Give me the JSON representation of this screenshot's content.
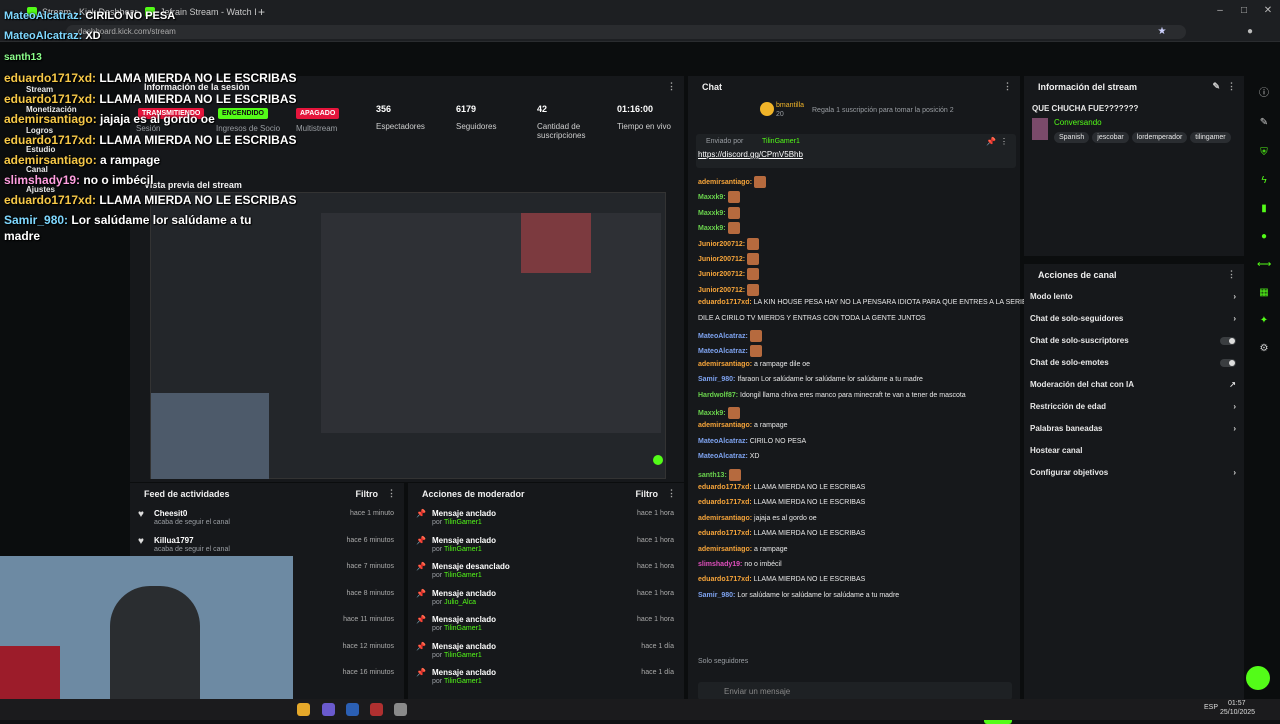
{
  "browser": {
    "tabs": [
      {
        "label": "Stream - Kick Dashboard"
      },
      {
        "label": "Jefrain Stream - Watch Live on"
      }
    ],
    "url": "dashboard.kick.com/stream",
    "new_tab": "+"
  },
  "overlay": {
    "top_lines": [
      {
        "user": "MateoAlcatraz:",
        "msg": "CIRILO NO PESA"
      },
      {
        "user": "MateoAlcatraz:",
        "msg": "XD"
      }
    ],
    "lines": [
      {
        "user": "eduardo1717xd:",
        "msg": "LLAMA MIERDA NO LE ESCRIBAS"
      },
      {
        "user": "eduardo1717xd:",
        "msg": "LLAMA MIERDA NO LE ESCRIBAS"
      },
      {
        "user": "ademirsantiago:",
        "msg": "jajaja es al gordo oe"
      },
      {
        "user": "eduardo1717xd:",
        "msg": "LLAMA MIERDA NO LE ESCRIBAS"
      },
      {
        "user": "ademirsantiago:",
        "msg": "a rampage"
      },
      {
        "user": "slimshady19:",
        "msg": "no o imbécil"
      },
      {
        "user": "eduardo1717xd:",
        "msg": "LLAMA MIERDA NO LE ESCRIBAS"
      },
      {
        "user": "Samir_980:",
        "msg": "Lor salúdame lor salúdame a tu"
      },
      {
        "user": "",
        "msg": "madre"
      }
    ],
    "partial_name": "santh13"
  },
  "sidebar": {
    "items": [
      {
        "label": "Stream"
      },
      {
        "label": "Monetización"
      },
      {
        "label": "Logros"
      },
      {
        "label": "Estudio"
      },
      {
        "label": "Canal"
      },
      {
        "label": "Ajustes"
      }
    ]
  },
  "session": {
    "header": "Información de la sesión",
    "status_live": "TRANSMITIENDO",
    "status_on": "ENCENDIDO",
    "status_off": "APAGADO",
    "session_label": "Sesión",
    "partner_label": "Ingresos de Socio",
    "multistream_label": "Multistream",
    "stats": [
      {
        "value": "356",
        "label": "Espectadores"
      },
      {
        "value": "6179",
        "label": "Seguidores"
      },
      {
        "value": "42",
        "label": "Cantidad de suscripciones"
      },
      {
        "value": "01:16:00",
        "label": "Tiempo en vivo"
      }
    ]
  },
  "preview": {
    "header": "Vista previa del stream"
  },
  "activity_feed": {
    "header": "Feed de actividades",
    "filter": "Filtro",
    "rows": [
      {
        "title": "Cheesit0",
        "sub": "acaba de seguir el canal",
        "time": "hace 1 minuto"
      },
      {
        "title": "Killua1797",
        "sub": "acaba de seguir el canal",
        "time": "hace 6 minutos"
      },
      {
        "title": "",
        "sub": "",
        "time": "hace 7 minutos"
      },
      {
        "title": "",
        "sub": "",
        "time": "hace 8 minutos"
      },
      {
        "title": "",
        "sub": "",
        "time": "hace 11 minutos"
      },
      {
        "title": "",
        "sub": "",
        "time": "hace 12 minutos"
      },
      {
        "title": "",
        "sub": "",
        "time": "hace 16 minutos"
      }
    ]
  },
  "mod_actions": {
    "header": "Acciones de moderador",
    "filter": "Filtro",
    "rows": [
      {
        "title": "Mensaje anclado",
        "by": "TilinGamer1",
        "time": "hace 1 hora"
      },
      {
        "title": "Mensaje anclado",
        "by": "TilinGamer1",
        "time": "hace 1 hora"
      },
      {
        "title": "Mensaje desanclado",
        "by": "TilinGamer1",
        "time": "hace 1 hora"
      },
      {
        "title": "Mensaje anclado",
        "by": "Julio_Alca",
        "time": "hace 1 hora"
      },
      {
        "title": "Mensaje anclado",
        "by": "TilinGamer1",
        "time": "hace 1 hora"
      },
      {
        "title": "Mensaje anclado",
        "by": "TilinGamer1",
        "time": "hace 1 día"
      },
      {
        "title": "Mensaje anclado",
        "by": "TilinGamer1",
        "time": "hace 1 día"
      }
    ],
    "por": "por"
  },
  "chat": {
    "header": "Chat",
    "top_user": "bmantilla",
    "top_count": "20",
    "gift_text": "Regala 1 suscripción para tomar la posición 2",
    "pinned_by": "Enviado por",
    "pinned_user": "TilinGamer1",
    "pinned_link": "https://discord.gg/CPmV5Bhb",
    "messages": [
      {
        "user": "ademirsantiago:",
        "msg": "",
        "cls": "u1",
        "emote": true
      },
      {
        "user": "Maxxk9:",
        "msg": "",
        "cls": "u2",
        "emote": true
      },
      {
        "user": "Maxxk9:",
        "msg": "",
        "cls": "u2",
        "emote": true
      },
      {
        "user": "Maxxk9:",
        "msg": "",
        "cls": "u2",
        "emote": true
      },
      {
        "user": "Junior200712:",
        "msg": "",
        "cls": "u1",
        "emote": true
      },
      {
        "user": "Junior200712:",
        "msg": "",
        "cls": "u1",
        "emote": true
      },
      {
        "user": "Junior200712:",
        "msg": "",
        "cls": "u1",
        "emote": true
      },
      {
        "user": "Junior200712:",
        "msg": "",
        "cls": "u1",
        "emote": true
      },
      {
        "user": "eduardo1717xd:",
        "msg": "LA KIN HOUSE PESA HAY NO LA PENSARA IDIOTA PARA QUE ENTRES A LA SERIE",
        "cls": "u1",
        "emote": false
      },
      {
        "user": "",
        "msg": "DILE A CIRILO TV MIERDS Y ENTRAS CON TODA LA GENTE JUNTOS",
        "cls": "u1",
        "emote": false
      },
      {
        "user": "MateoAlcatraz:",
        "msg": "",
        "cls": "u3",
        "emote": true
      },
      {
        "user": "MateoAlcatraz:",
        "msg": "",
        "cls": "u3",
        "emote": true
      },
      {
        "user": "ademirsantiago:",
        "msg": "a rampage dile oe",
        "cls": "u1",
        "emote": false
      },
      {
        "user": "Samir_980:",
        "msg": "Ifaraon Lor salúdame lor salúdame lor salúdame a tu madre",
        "cls": "u3",
        "emote": false
      },
      {
        "user": "Hardwolf87:",
        "msg": "Idongil llama chiva eres manco para minecraft te van a tener de mascota",
        "cls": "u2",
        "emote": false
      },
      {
        "user": "Maxxk9:",
        "msg": "",
        "cls": "u2",
        "emote": true
      },
      {
        "user": "ademirsantiago:",
        "msg": "a rampage",
        "cls": "u1",
        "emote": false
      },
      {
        "user": "MateoAlcatraz:",
        "msg": "CIRILO NO PESA",
        "cls": "u3",
        "emote": false
      },
      {
        "user": "MateoAlcatraz:",
        "msg": "XD",
        "cls": "u3",
        "emote": false
      },
      {
        "user": "santh13:",
        "msg": "",
        "cls": "u2",
        "emote": true
      },
      {
        "user": "eduardo1717xd:",
        "msg": "LLAMA MIERDA NO LE ESCRIBAS",
        "cls": "u1",
        "emote": false
      },
      {
        "user": "eduardo1717xd:",
        "msg": "LLAMA MIERDA NO LE ESCRIBAS",
        "cls": "u1",
        "emote": false
      },
      {
        "user": "ademirsantiago:",
        "msg": "jajaja es al gordo oe",
        "cls": "u1",
        "emote": false
      },
      {
        "user": "eduardo1717xd:",
        "msg": "LLAMA MIERDA NO LE ESCRIBAS",
        "cls": "u1",
        "emote": false
      },
      {
        "user": "ademirsantiago:",
        "msg": "a rampage",
        "cls": "u1",
        "emote": false
      },
      {
        "user": "slimshady19:",
        "msg": "no o imbécil",
        "cls": "u4",
        "emote": false
      },
      {
        "user": "eduardo1717xd:",
        "msg": "LLAMA MIERDA NO LE ESCRIBAS",
        "cls": "u1",
        "emote": false
      },
      {
        "user": "Samir_980:",
        "msg": "Lor salúdame lor salúdame lor salúdame a tu madre",
        "cls": "u3",
        "emote": false
      }
    ],
    "followers_only": "Solo seguidores",
    "input_placeholder": "Enviar un mensaje",
    "send_label": "Chat"
  },
  "stream_info": {
    "header": "Información del stream",
    "title": "QUE CHUCHA FUE???????",
    "category": "Conversando",
    "tags": [
      "Spanish",
      "jescobar",
      "lordemperador",
      "tilingamer"
    ]
  },
  "channel_actions": {
    "header": "Acciones de canal",
    "items": [
      {
        "label": "Modo lento",
        "kind": "arrow"
      },
      {
        "label": "Chat de solo-seguidores",
        "kind": "arrow"
      },
      {
        "label": "Chat de solo-suscriptores",
        "kind": "toggle"
      },
      {
        "label": "Chat de solo-emotes",
        "kind": "toggle"
      },
      {
        "label": "Moderación del chat con IA",
        "kind": "link"
      },
      {
        "label": "Restricción de edad",
        "kind": "arrow"
      },
      {
        "label": "Palabras baneadas",
        "kind": "arrow"
      },
      {
        "label": "Hostear canal",
        "kind": "none"
      },
      {
        "label": "Configurar objetivos",
        "kind": "arrow"
      }
    ]
  },
  "taskbar": {
    "lang": "ESP",
    "time": "01:57",
    "date": "25/10/2025"
  },
  "colors": {
    "accent": "#53fc18",
    "live": "#e5153c"
  }
}
